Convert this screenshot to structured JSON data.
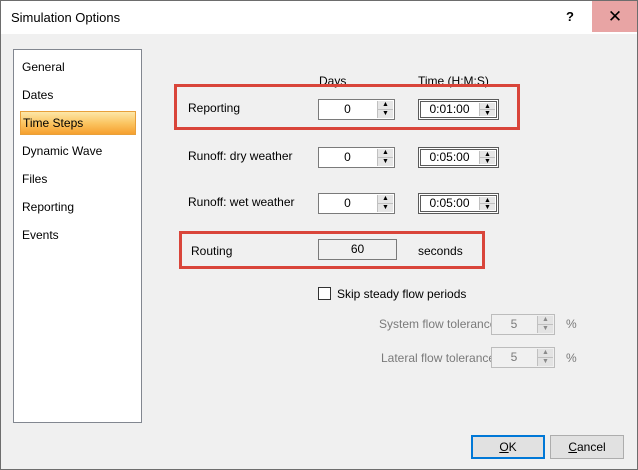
{
  "window": {
    "title": "Simulation Options",
    "help_label": "?",
    "close_label": "✕"
  },
  "sidebar": {
    "items": [
      {
        "label": "General",
        "selected": false
      },
      {
        "label": "Dates",
        "selected": false
      },
      {
        "label": "Time Steps",
        "selected": true
      },
      {
        "label": "Dynamic Wave",
        "selected": false
      },
      {
        "label": "Files",
        "selected": false
      },
      {
        "label": "Reporting",
        "selected": false
      },
      {
        "label": "Events",
        "selected": false
      }
    ]
  },
  "columns": {
    "days": "Days",
    "time": "Time (H:M:S)"
  },
  "rows": {
    "reporting": {
      "label": "Reporting",
      "days": "0",
      "time": "0:01:00"
    },
    "runoff_dry": {
      "label": "Runoff: dry weather",
      "days": "0",
      "time": "0:05:00"
    },
    "runoff_wet": {
      "label": "Runoff: wet weather",
      "days": "0",
      "time": "0:05:00"
    }
  },
  "routing": {
    "label": "Routing",
    "value": "60",
    "unit": "seconds"
  },
  "steady_flow": {
    "label": "Skip steady flow periods",
    "checked": false,
    "system_tolerance_label": "System flow tolerance",
    "system_tolerance_value": "5",
    "system_tolerance_unit": "%",
    "lateral_tolerance_label": "Lateral flow tolerance",
    "lateral_tolerance_value": "5",
    "lateral_tolerance_unit": "%"
  },
  "buttons": {
    "ok_first": "O",
    "ok_rest": "K",
    "cancel_first": "C",
    "cancel_rest": "ancel"
  },
  "colors": {
    "highlight": "#d9453a",
    "selection": "#fbc562",
    "default_button_border": "#0078d7"
  },
  "icons": {
    "spin_up": "▲",
    "spin_down": "▼"
  }
}
